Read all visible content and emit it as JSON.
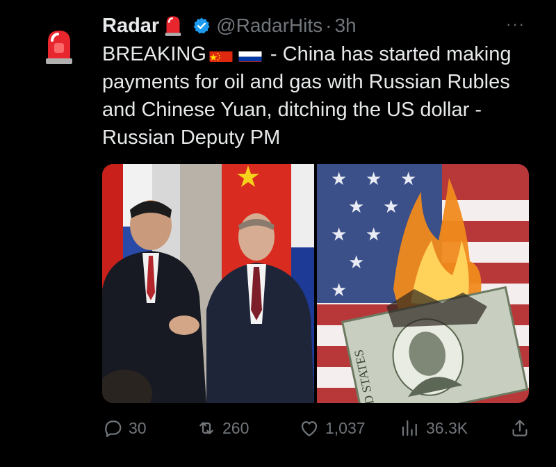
{
  "tweet": {
    "author_name": "Radar",
    "handle": "@RadarHits",
    "separator": "·",
    "time": "3h",
    "more_label": "···",
    "text_prefix": "BREAKING",
    "text_body": " - China has started making payments for oil and gas with Russian Rubles and Chinese Yuan, ditching the US dollar - Russian Deputy PM",
    "icons": {
      "avatar": "siren-icon",
      "verified": "verified-badge-icon",
      "flags": [
        "china-flag-icon",
        "russia-flag-icon"
      ]
    }
  },
  "media": [
    {
      "name": "handshake-photo"
    },
    {
      "name": "burning-dollar-photo"
    }
  ],
  "actions": {
    "replies": "30",
    "reposts": "260",
    "likes": "1,037",
    "views": "36.3K"
  },
  "colors": {
    "background": "#000000",
    "text": "#e7e9ea",
    "muted": "#71767b",
    "verified": "#1d9bf0"
  }
}
